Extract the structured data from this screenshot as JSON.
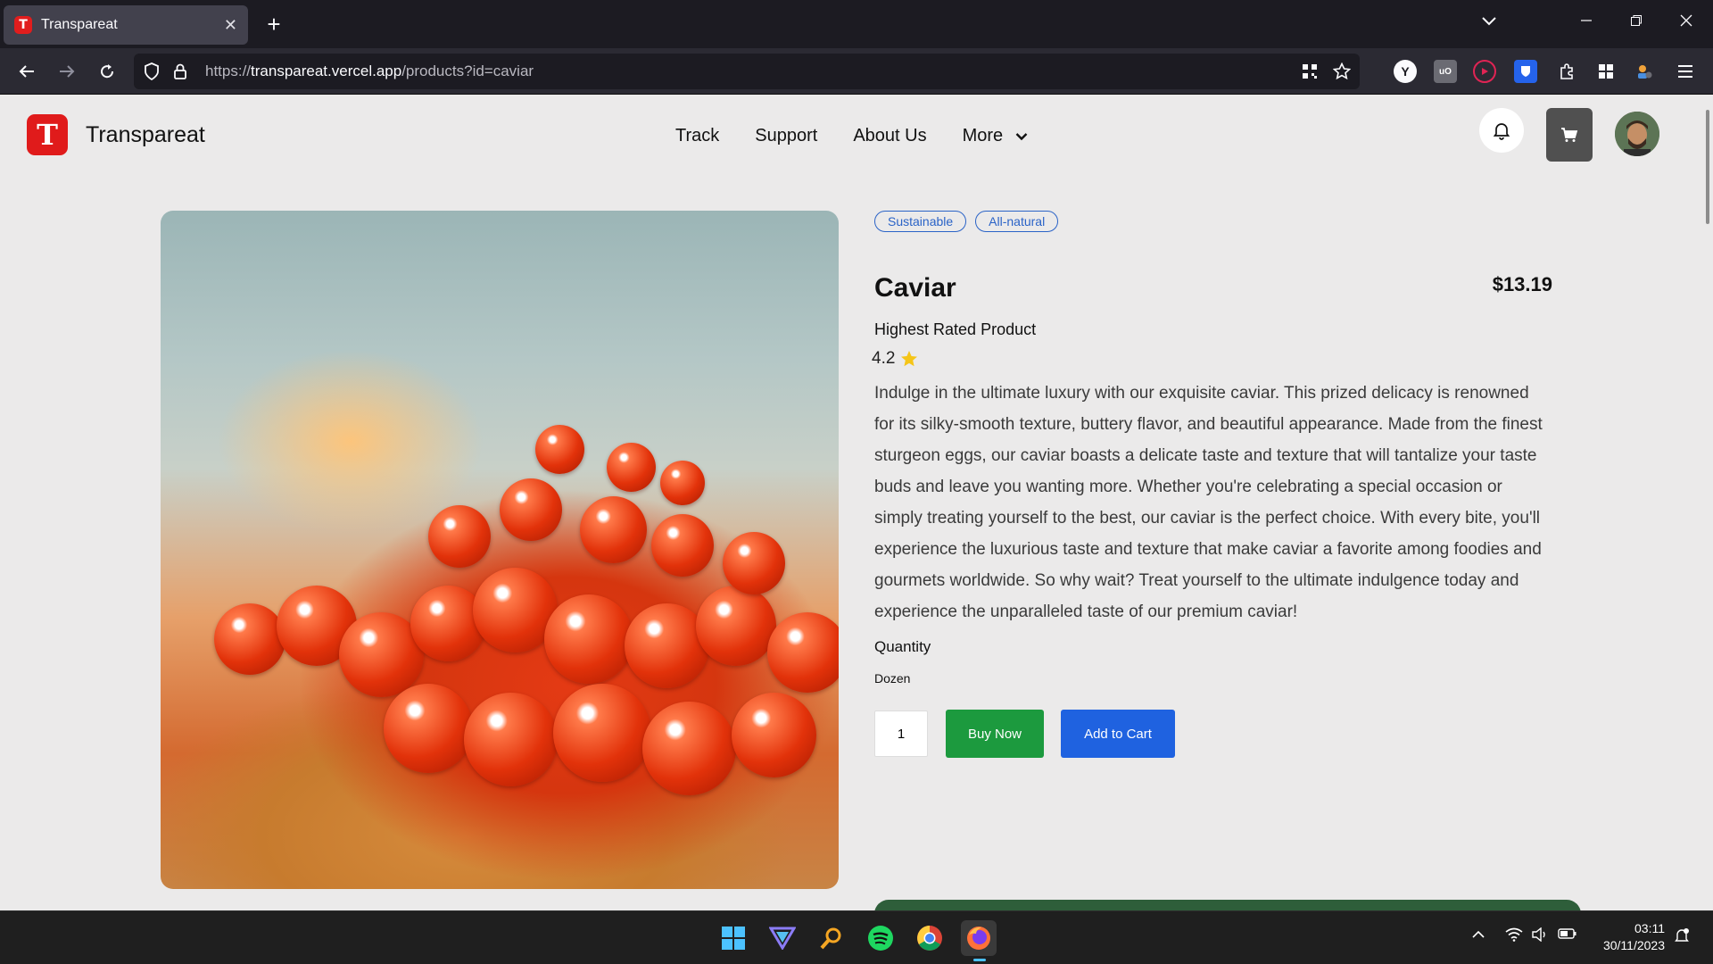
{
  "browser": {
    "tab_title": "Transpareat",
    "tab_favicon_letter": "T",
    "url_scheme": "https://",
    "url_host": "transpareat.vercel.app",
    "url_path": "/products?id=caviar",
    "new_tab_symbol": "+",
    "close_symbol": "✕"
  },
  "site": {
    "logo_letter": "T",
    "brand": "Transpareat",
    "menu": {
      "track": "Track",
      "support": "Support",
      "about": "About Us",
      "more": "More"
    }
  },
  "product": {
    "tags": [
      "Sustainable",
      "All-natural"
    ],
    "name": "Caviar",
    "price": "$13.19",
    "subtitle": "Highest Rated Product",
    "rating": "4.2",
    "description": "Indulge in the ultimate luxury with our exquisite caviar. This prized delicacy is renowned for its silky-smooth texture, buttery flavor, and beautiful appearance. Made from the finest sturgeon eggs, our caviar boasts a delicate taste and texture that will tantalize your taste buds and leave you wanting more. Whether you're celebrating a special occasion or simply treating yourself to the best, our caviar is the perfect choice. With every bite, you'll experience the luxurious taste and texture that make caviar a favorite among foodies and gourmets worldwide. So why wait? Treat yourself to the ultimate indulgence today and experience the unparalleled taste of our premium caviar!",
    "quantity_label": "Quantity",
    "unit": "Dozen",
    "quantity_value": "1",
    "buy_now": "Buy Now",
    "add_to_cart": "Add to Cart"
  },
  "colors": {
    "brand_red": "#e01b1b",
    "buy_green": "#1c9a3e",
    "cart_blue": "#1f62e0",
    "tag_blue": "#2a63c7"
  },
  "taskbar": {
    "time": "03:11",
    "date": "30/11/2023",
    "apps": [
      "windows-start",
      "proton-vpn",
      "search",
      "spotify",
      "chrome",
      "firefox"
    ]
  }
}
